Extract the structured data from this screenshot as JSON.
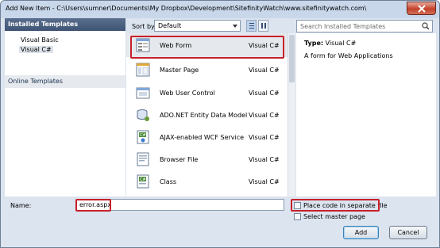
{
  "window": {
    "title": "Add New Item - C:\\Users\\sumner\\Documents\\My Dropbox\\Development\\SitefinityWatch\\www.sitefinitywatch.com\\"
  },
  "left_panel": {
    "installed_header": "Installed Templates",
    "items": [
      {
        "label": "Visual Basic",
        "selected": false
      },
      {
        "label": "Visual C#",
        "selected": true
      }
    ],
    "online_header": "Online Templates"
  },
  "sort": {
    "label": "Sort by:",
    "value": "Default"
  },
  "search": {
    "placeholder": "Search Installed Templates",
    "icon": "magnifier-icon"
  },
  "templates": [
    {
      "name": "Web Form",
      "lang": "Visual C#",
      "icon": "web-form-icon",
      "selected": true
    },
    {
      "name": "Master Page",
      "lang": "Visual C#",
      "icon": "master-page-icon"
    },
    {
      "name": "Web User Control",
      "lang": "Visual C#",
      "icon": "web-user-control-icon"
    },
    {
      "name": "ADO.NET Entity Data Model",
      "lang": "Visual C#",
      "icon": "entity-data-model-icon"
    },
    {
      "name": "AJAX-enabled WCF Service",
      "lang": "Visual C#",
      "icon": "wcf-service-icon"
    },
    {
      "name": "Browser File",
      "lang": "Visual C#",
      "icon": "browser-file-icon"
    },
    {
      "name": "Class",
      "lang": "Visual C#",
      "icon": "class-icon"
    }
  ],
  "details": {
    "type_label": "Type:",
    "type_value": "Visual C#",
    "description": "A form for Web Applications"
  },
  "bottom": {
    "name_label": "Name:",
    "name_value": "error.aspx",
    "place_code_label": "Place code in separate file",
    "place_code_checked": false,
    "select_master_label": "Select master page",
    "select_master_checked": false,
    "add_label": "Add",
    "cancel_label": "Cancel"
  },
  "colors": {
    "highlight": "#c8202b",
    "left_header": "#3f5474",
    "window_bg": "#dbe4ef"
  }
}
